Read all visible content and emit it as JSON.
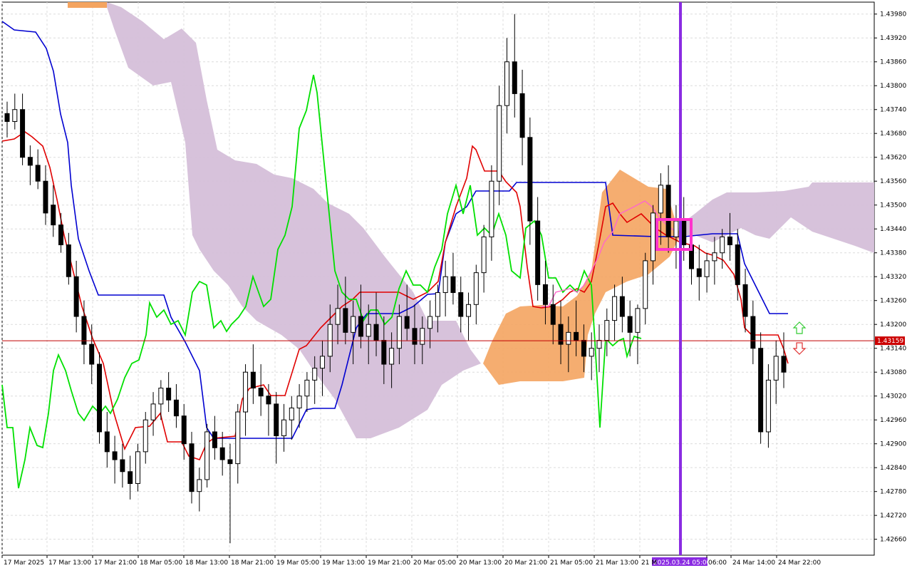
{
  "chart_data": {
    "type": "candlestick",
    "instrument_price_label": "1.43159",
    "y_range": [
      1.4262,
      1.4401
    ],
    "grid": true,
    "y_ticks": [
      "1.43980",
      "1.43920",
      "1.43860",
      "1.43800",
      "1.43740",
      "1.43680",
      "1.43620",
      "1.43560",
      "1.43500",
      "1.43440",
      "1.43380",
      "1.43320",
      "1.43260",
      "1.43200",
      "1.43140",
      "1.43080",
      "1.43020",
      "1.42960",
      "1.42900",
      "1.42840",
      "1.42780",
      "1.42720",
      "1.42660"
    ],
    "x_ticks": [
      "17 Mar 2025",
      "17 Mar 13:00",
      "17 Mar 21:00",
      "18 Mar 05:00",
      "18 Mar 13:00",
      "18 Mar 21:00",
      "19 Mar 05:00",
      "19 Mar 13:00",
      "19 Mar 21:00",
      "20 Mar 05:00",
      "20 Mar 13:00",
      "20 Mar 21:00",
      "21 Mar 05:00",
      "21 Mar 13:00",
      "21 M",
      "06:00",
      "24 Mar 14:00",
      "24 Mar 22:00"
    ],
    "crosshair_time_label": "2025.03.24 05:00",
    "current_price": 1.43159,
    "ohlc_bars": [
      [
        1.4373,
        1.4376,
        1.4367,
        1.4371
      ],
      [
        1.4371,
        1.4378,
        1.4369,
        1.4374
      ],
      [
        1.4374,
        1.4378,
        1.436,
        1.4362
      ],
      [
        1.4362,
        1.4365,
        1.4355,
        1.436
      ],
      [
        1.436,
        1.4364,
        1.4354,
        1.4356
      ],
      [
        1.4356,
        1.436,
        1.4345,
        1.4348
      ],
      [
        1.435,
        1.4355,
        1.4342,
        1.4345
      ],
      [
        1.4345,
        1.4348,
        1.4338,
        1.434
      ],
      [
        1.434,
        1.4343,
        1.433,
        1.4332
      ],
      [
        1.4332,
        1.4336,
        1.4318,
        1.4322
      ],
      [
        1.4322,
        1.4326,
        1.431,
        1.4315
      ],
      [
        1.4315,
        1.432,
        1.4305,
        1.431
      ],
      [
        1.431,
        1.4313,
        1.429,
        1.4293
      ],
      [
        1.4293,
        1.4298,
        1.4284,
        1.4288
      ],
      [
        1.4288,
        1.4292,
        1.428,
        1.4286
      ],
      [
        1.4286,
        1.429,
        1.4279,
        1.4283
      ],
      [
        1.4283,
        1.4287,
        1.4276,
        1.428
      ],
      [
        1.428,
        1.429,
        1.4278,
        1.4288
      ],
      [
        1.4288,
        1.4298,
        1.4285,
        1.4296
      ],
      [
        1.4296,
        1.4303,
        1.4292,
        1.43
      ],
      [
        1.43,
        1.4306,
        1.4296,
        1.4304
      ],
      [
        1.4304,
        1.4308,
        1.4298,
        1.4301
      ],
      [
        1.4301,
        1.4305,
        1.4294,
        1.4297
      ],
      [
        1.4297,
        1.43,
        1.4286,
        1.429
      ],
      [
        1.429,
        1.4293,
        1.4275,
        1.4278
      ],
      [
        1.4278,
        1.4284,
        1.4273,
        1.4281
      ],
      [
        1.4281,
        1.4295,
        1.4279,
        1.4293
      ],
      [
        1.4293,
        1.4297,
        1.4286,
        1.4289
      ],
      [
        1.4289,
        1.4293,
        1.4282,
        1.4286
      ],
      [
        1.4286,
        1.429,
        1.4265,
        1.4285
      ],
      [
        1.4285,
        1.43,
        1.428,
        1.4298
      ],
      [
        1.4298,
        1.431,
        1.4292,
        1.4308
      ],
      [
        1.4308,
        1.4315,
        1.43,
        1.4304
      ],
      [
        1.4304,
        1.431,
        1.4297,
        1.4302
      ],
      [
        1.4302,
        1.4305,
        1.4292,
        1.43
      ],
      [
        1.43,
        1.4303,
        1.4285,
        1.4292
      ],
      [
        1.4292,
        1.43,
        1.4288,
        1.4296
      ],
      [
        1.4296,
        1.4302,
        1.4291,
        1.4299
      ],
      [
        1.4299,
        1.4305,
        1.4294,
        1.4302
      ],
      [
        1.4302,
        1.4308,
        1.4298,
        1.4306
      ],
      [
        1.4306,
        1.4312,
        1.43,
        1.4309
      ],
      [
        1.4309,
        1.4316,
        1.4302,
        1.4312
      ],
      [
        1.4312,
        1.4325,
        1.4308,
        1.432
      ],
      [
        1.432,
        1.433,
        1.4315,
        1.4324
      ],
      [
        1.4324,
        1.4332,
        1.4315,
        1.4318
      ],
      [
        1.4318,
        1.4326,
        1.431,
        1.4322
      ],
      [
        1.4322,
        1.433,
        1.4314,
        1.4317
      ],
      [
        1.4317,
        1.4325,
        1.431,
        1.432
      ],
      [
        1.432,
        1.4328,
        1.4312,
        1.4316
      ],
      [
        1.4316,
        1.4322,
        1.4305,
        1.431
      ],
      [
        1.431,
        1.4318,
        1.4304,
        1.4314
      ],
      [
        1.4314,
        1.4325,
        1.431,
        1.4322
      ],
      [
        1.4322,
        1.433,
        1.4316,
        1.4319
      ],
      [
        1.4319,
        1.4325,
        1.431,
        1.4315
      ],
      [
        1.4315,
        1.4322,
        1.431,
        1.4319
      ],
      [
        1.4319,
        1.4326,
        1.4314,
        1.4322
      ],
      [
        1.4322,
        1.433,
        1.4318,
        1.4328
      ],
      [
        1.4328,
        1.4336,
        1.4322,
        1.4332
      ],
      [
        1.4332,
        1.4338,
        1.4325,
        1.4328
      ],
      [
        1.4328,
        1.4332,
        1.4318,
        1.4322
      ],
      [
        1.4322,
        1.4328,
        1.4316,
        1.4325
      ],
      [
        1.4325,
        1.4335,
        1.432,
        1.4333
      ],
      [
        1.4333,
        1.4345,
        1.4328,
        1.4342
      ],
      [
        1.4342,
        1.436,
        1.4336,
        1.4356
      ],
      [
        1.4356,
        1.438,
        1.435,
        1.4375
      ],
      [
        1.4375,
        1.4392,
        1.4368,
        1.4386
      ],
      [
        1.4386,
        1.4398,
        1.4372,
        1.4378
      ],
      [
        1.4378,
        1.4384,
        1.436,
        1.4367
      ],
      [
        1.4367,
        1.4372,
        1.434,
        1.4346
      ],
      [
        1.4346,
        1.4352,
        1.4326,
        1.433
      ],
      [
        1.433,
        1.4336,
        1.432,
        1.4325
      ],
      [
        1.4325,
        1.433,
        1.4315,
        1.432
      ],
      [
        1.432,
        1.4326,
        1.431,
        1.4315
      ],
      [
        1.4315,
        1.4322,
        1.4308,
        1.4318
      ],
      [
        1.4318,
        1.4326,
        1.4312,
        1.4316
      ],
      [
        1.4316,
        1.432,
        1.4308,
        1.4312
      ],
      [
        1.4312,
        1.4318,
        1.4306,
        1.4314
      ],
      [
        1.4314,
        1.432,
        1.4308,
        1.4316
      ],
      [
        1.4316,
        1.4324,
        1.4312,
        1.4321
      ],
      [
        1.4321,
        1.433,
        1.4316,
        1.4327
      ],
      [
        1.4327,
        1.4332,
        1.4318,
        1.4322
      ],
      [
        1.4322,
        1.4326,
        1.4312,
        1.4318
      ],
      [
        1.4318,
        1.4325,
        1.431,
        1.4324
      ],
      [
        1.4324,
        1.4338,
        1.432,
        1.4336
      ],
      [
        1.4336,
        1.435,
        1.433,
        1.4348
      ],
      [
        1.4348,
        1.4358,
        1.434,
        1.4355
      ],
      [
        1.4355,
        1.436,
        1.4338,
        1.4342
      ],
      [
        1.4342,
        1.435,
        1.4334,
        1.4346
      ],
      [
        1.4346,
        1.4352,
        1.4336,
        1.434
      ],
      [
        1.434,
        1.4346,
        1.433,
        1.4334
      ],
      [
        1.4334,
        1.434,
        1.4326,
        1.4332
      ],
      [
        1.4332,
        1.4338,
        1.4328,
        1.4336
      ],
      [
        1.4336,
        1.4342,
        1.433,
        1.4338
      ],
      [
        1.4338,
        1.4344,
        1.4334,
        1.4342
      ],
      [
        1.4342,
        1.4348,
        1.4336,
        1.434
      ],
      [
        1.434,
        1.4344,
        1.4326,
        1.433
      ],
      [
        1.433,
        1.4334,
        1.4318,
        1.4322
      ],
      [
        1.4322,
        1.4326,
        1.431,
        1.4314
      ],
      [
        1.4314,
        1.4318,
        1.429,
        1.4293
      ],
      [
        1.4293,
        1.431,
        1.4289,
        1.4306
      ],
      [
        1.4306,
        1.4316,
        1.43,
        1.4312
      ],
      [
        1.4312,
        1.4318,
        1.4304,
        1.4308
      ]
    ],
    "indicators": [
      {
        "type": "ichimoku_cloud",
        "colors": {
          "bearish_cloud": "#d5bfd9",
          "bullish_cloud": "#f4a460",
          "tenkan": "#e00000",
          "kijun": "#0000d0",
          "chikou": "#00e000"
        }
      },
      {
        "type": "signal_arrows",
        "colors": {
          "up": "#33cc33",
          "down": "#e03030"
        }
      },
      {
        "type": "vertical_marker",
        "color": "#8a2be2"
      },
      {
        "type": "highlight_box",
        "color": "#ff33cc"
      }
    ]
  }
}
